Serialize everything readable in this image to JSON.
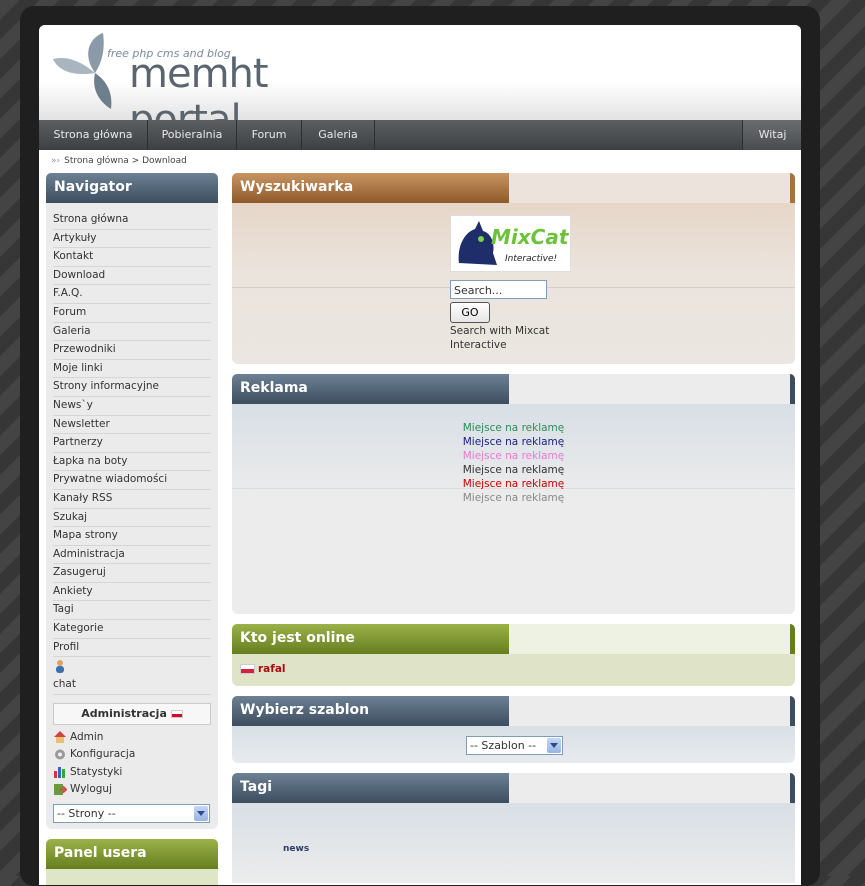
{
  "brand": {
    "tagline": "free php cms and blog",
    "title": "memht portal"
  },
  "topnav": {
    "items": [
      "Strona główna",
      "Pobieralnia",
      "Forum",
      "Galeria"
    ],
    "right": "Witaj"
  },
  "breadcrumb": {
    "home": "Strona główna",
    "sep": ">",
    "current": "Download"
  },
  "navigator": {
    "title": "Navigator",
    "links": [
      "Strona główna",
      "Artykuły",
      "Kontakt",
      "Download",
      "F.A.Q.",
      "Forum",
      "Galeria",
      "Przewodniki",
      "Moje linki",
      "Strony informacyjne",
      "News`y",
      "Newsletter",
      "Partnerzy",
      "Łapka na boty",
      "Prywatne wiadomości",
      "Kanały RSS",
      "Szukaj",
      "Mapa strony",
      "Administracja",
      "Zasugeruj",
      "Ankiety",
      "Tagi",
      "Kategorie",
      "Profil"
    ],
    "chat": "chat",
    "admin_title": "Administracja",
    "admin_items": [
      "Admin",
      "Konfiguracja",
      "Statystyki",
      "Wyloguj"
    ],
    "select_value": "-- Strony --"
  },
  "panel_user": {
    "title": "Panel usera"
  },
  "search_box": {
    "title": "Wyszukiwarka",
    "logo_text": "MixCat",
    "logo_sub": "Interactive!",
    "input_value": "Search...",
    "button": "GO",
    "caption_line1": "Search with Mixcat",
    "caption_line2": "Interactive"
  },
  "ads": {
    "title": "Reklama",
    "lines": [
      {
        "text": "Miejsce na reklamę",
        "color": "#2e8b57"
      },
      {
        "text": "Miejsce na reklamę",
        "color": "#1a237e"
      },
      {
        "text": "Miejsce na reklamę",
        "color": "#e87ad0"
      },
      {
        "text": "Miejsce na reklamę",
        "color": "#333333"
      },
      {
        "text": "Miejsce na reklamę",
        "color": "#cc0000"
      },
      {
        "text": "Miejsce na reklamę",
        "color": "#888888"
      }
    ]
  },
  "online": {
    "title": "Kto jest online",
    "user": "rafal"
  },
  "theme": {
    "title": "Wybierz szablon",
    "select_value": "-- Szablon --"
  },
  "tags": {
    "title": "Tagi",
    "items": [
      "news"
    ]
  }
}
